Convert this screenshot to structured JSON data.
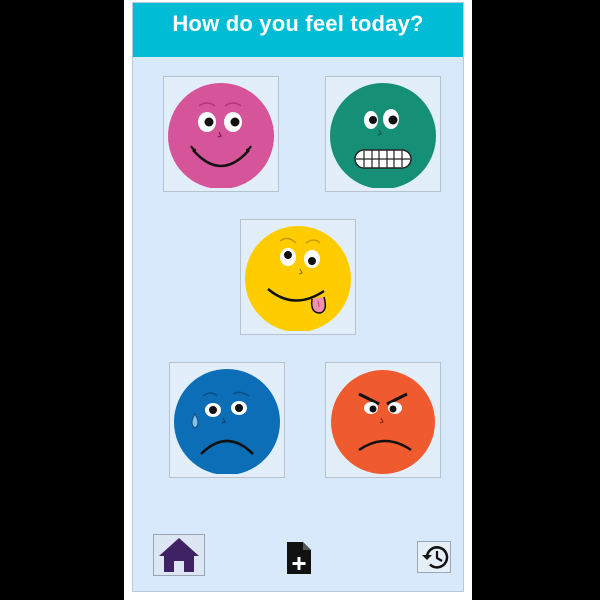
{
  "header": {
    "title": "How do you feel today?"
  },
  "colors": {
    "header_bg": "#00bcd4",
    "screen_bg": "#d7e9fb",
    "happy": "#d6549a",
    "grimace": "#168f77",
    "silly": "#ffcc00",
    "sad": "#0c6eb6",
    "angry": "#f05a2f",
    "home_icon": "#3f2263"
  },
  "moods": [
    {
      "name": "happy",
      "icon": "happy-face-icon"
    },
    {
      "name": "grimacing",
      "icon": "grimacing-face-icon"
    },
    {
      "name": "silly",
      "icon": "silly-face-icon"
    },
    {
      "name": "sad",
      "icon": "sad-face-icon"
    },
    {
      "name": "angry",
      "icon": "angry-face-icon"
    }
  ],
  "nav": [
    {
      "icon": "home-icon"
    },
    {
      "icon": "add-document-icon"
    },
    {
      "icon": "history-icon"
    }
  ]
}
